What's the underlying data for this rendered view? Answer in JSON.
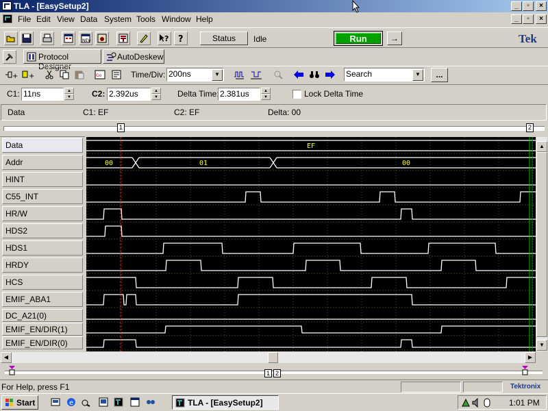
{
  "window": {
    "title": "TLA - [EasySetup2]"
  },
  "menu": [
    "File",
    "Edit",
    "View",
    "Data",
    "System",
    "Tools",
    "Window",
    "Help"
  ],
  "toolbar1": {
    "status_label": "Status",
    "status_value": "Idle",
    "run_label": "Run",
    "arrow_label": "→",
    "logo": "Tek"
  },
  "toolbar2": {
    "protocol_designer": "Protocol Designer",
    "autodeskew": "AutoDeskew"
  },
  "toolbar3": {
    "time_div_label": "Time/Div:",
    "time_div_value": "200ns",
    "search_value": "Search",
    "more_label": "..."
  },
  "cursors": {
    "c1_label": "C1:",
    "c1_value": "11ns",
    "c2_label": "C2:",
    "c2_value": "2.392us",
    "delta_label": "Delta Time:",
    "delta_value": "2.381us",
    "lock_label": "Lock Delta Time"
  },
  "readout": {
    "name": "Data",
    "c1": "C1: EF",
    "c2": "C2: EF",
    "delta": "Delta: 00"
  },
  "overview": {
    "marker1": "1",
    "marker2": "2"
  },
  "signals": [
    "Data",
    "Addr",
    "HINT",
    "C55_INT",
    "HR/W",
    "HDS2",
    "HDS1",
    "HRDY",
    "HCS",
    "EMIF_ABA1",
    "DC_A21(0)",
    "EMIF_EN/DIR(1)",
    "EMIF_EN/DIR(0)"
  ],
  "bus_values": {
    "data": "EF",
    "addr": [
      "00",
      "01",
      "00"
    ]
  },
  "bottom_markers": {
    "m1": "1",
    "m2": "2"
  },
  "statusbar": {
    "help": "For Help, press F1",
    "brand": "Tektronix"
  },
  "taskbar": {
    "start": "Start",
    "task": "TLA - [EasySetup2]",
    "clock": "1:01 PM"
  },
  "colors": {
    "title_start": "#0a246a",
    "title_end": "#a6caf0",
    "run_green": "#00a000",
    "waveform": "#ffffff",
    "bus_text": "#ffff00",
    "cursor1": "#ff0000",
    "cursor2": "#00c000",
    "trace_bg": "#000000"
  }
}
